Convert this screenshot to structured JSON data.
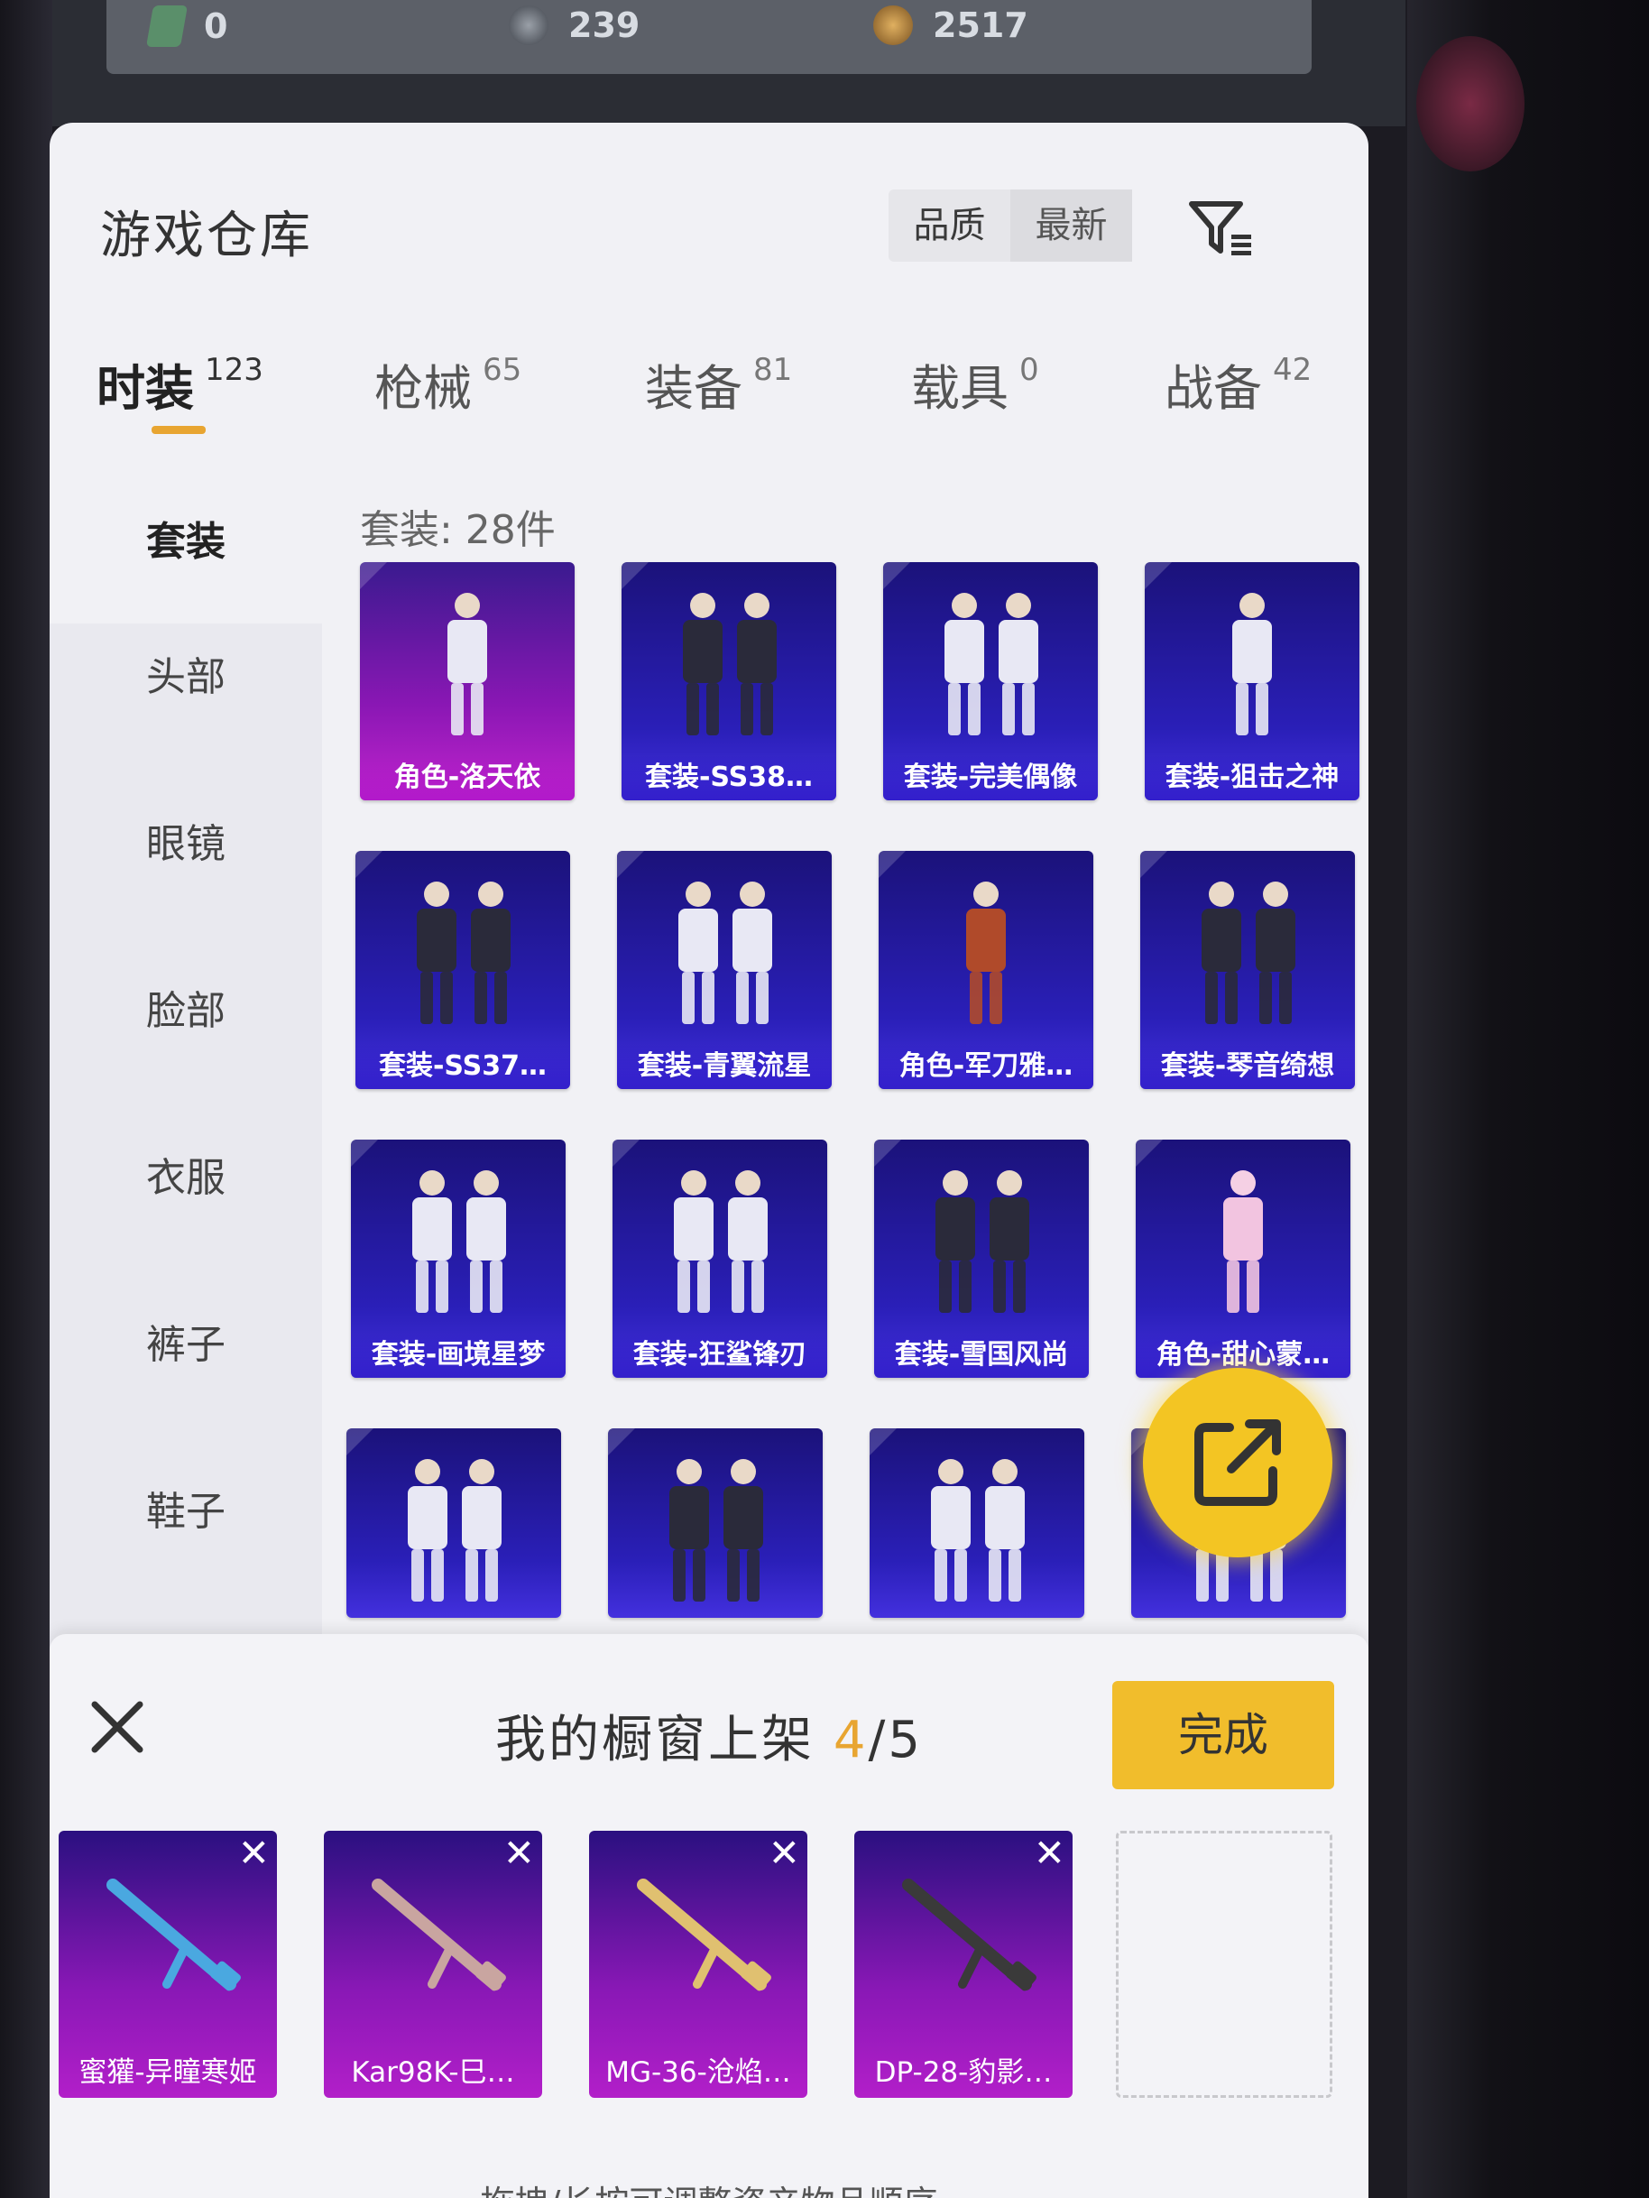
{
  "currency": [
    {
      "icon": "ticket-icon",
      "value": "0",
      "color": "#5a8f6a"
    },
    {
      "icon": "coin-icon",
      "value": "239",
      "color": "#6b7280"
    },
    {
      "icon": "gold-coin-icon",
      "value": "2517",
      "color": "#b8863b"
    }
  ],
  "header": {
    "title": "游戏仓库",
    "sort_quality": "品质",
    "sort_latest": "最新",
    "filter_icon": "filter-icon"
  },
  "tabs": [
    {
      "label": "时装",
      "count": "123",
      "active": true
    },
    {
      "label": "枪械",
      "count": "65"
    },
    {
      "label": "装备",
      "count": "81"
    },
    {
      "label": "载具",
      "count": "0"
    },
    {
      "label": "战备",
      "count": "42"
    }
  ],
  "sidebar": [
    "套装",
    "头部",
    "眼镜",
    "脸部",
    "衣服",
    "裤子",
    "鞋子"
  ],
  "main": {
    "subtitle": "套装: 28件"
  },
  "items": [
    {
      "label": "角色-洛天依",
      "style": "pink"
    },
    {
      "label": "套装-SS38…",
      "style": "blue"
    },
    {
      "label": "套装-完美偶像",
      "style": "blue"
    },
    {
      "label": "套装-狙击之神",
      "style": "blue"
    },
    {
      "label": "套装-SS37…",
      "style": "blue"
    },
    {
      "label": "套装-青翼流星",
      "style": "blue"
    },
    {
      "label": "角色-军刀雅…",
      "style": "blue"
    },
    {
      "label": "套装-琴音绮想",
      "style": "blue"
    },
    {
      "label": "套装-画境星梦",
      "style": "blue"
    },
    {
      "label": "套装-狂鲨锋刃",
      "style": "blue"
    },
    {
      "label": "套装-雪国风尚",
      "style": "blue"
    },
    {
      "label": "角色-甜心蒙…",
      "style": "blue"
    },
    {
      "label": "",
      "style": "blue"
    },
    {
      "label": "",
      "style": "blue"
    },
    {
      "label": "",
      "style": "blue"
    },
    {
      "label": "",
      "style": "blue"
    }
  ],
  "share_button": "share-icon",
  "showcase": {
    "title_prefix": "我的橱窗上架",
    "count": "4",
    "total": "/5",
    "done_label": "完成",
    "close_icon": "close-icon",
    "remove_glyph": "✕",
    "slots": [
      {
        "label": "蜜獾-异瞳寒姬"
      },
      {
        "label": "Kar98K-巳…"
      },
      {
        "label": "MG-36-沧焰…"
      },
      {
        "label": "DP-28-豹影…"
      }
    ],
    "hint": "拖拽/长按可调整资产物品顺序"
  },
  "colors": {
    "accent": "#e8a531",
    "done_button": "#f1bd2c",
    "share_button": "#f3c523"
  }
}
